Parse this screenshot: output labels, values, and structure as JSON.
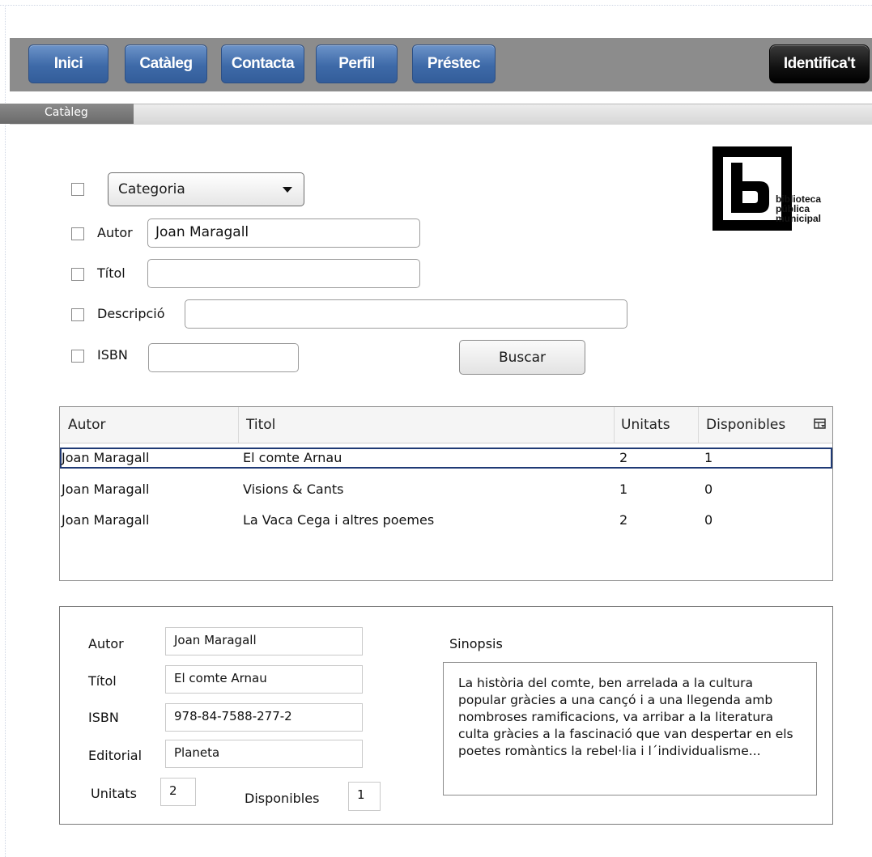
{
  "nav": {
    "inici": "Inici",
    "cataleg": "Catàleg",
    "contacta": "Contacta",
    "perfil": "Perfil",
    "prestec": "Préstec",
    "identificat": "Identifica't"
  },
  "tab": {
    "label": "Catàleg"
  },
  "search": {
    "category_select": "Categoria",
    "autor_label": "Autor",
    "autor_value": "Joan Maragall",
    "titol_label": "Títol",
    "titol_value": "",
    "descripcio_label": "Descripció",
    "descripcio_value": "",
    "isbn_label": "ISBN",
    "isbn_value": "",
    "search_button": "Buscar"
  },
  "logo": {
    "line1": "biblioteca",
    "line2": "pública",
    "line3": "municipal"
  },
  "results": {
    "columns": [
      "Autor",
      "Titol",
      "Unitats",
      "Disponibles"
    ],
    "rows": [
      [
        "Joan Maragall",
        "El comte Arnau",
        "2",
        "1"
      ],
      [
        "Joan Maragall",
        "Visions & Cants",
        "1",
        "0"
      ],
      [
        "Joan Maragall",
        "La Vaca Cega i altres poemes",
        "2",
        "0"
      ]
    ],
    "selected_row": 0
  },
  "detail": {
    "autor_label": "Autor",
    "autor_value": "Joan Maragall",
    "titol_label": "Títol",
    "titol_value": "El comte Arnau",
    "isbn_label": "ISBN",
    "isbn_value": "978-84-7588-277-2",
    "editorial_label": "Editorial",
    "editorial_value": "Planeta",
    "unitats_label": "Unitats",
    "unitats_value": "2",
    "disponibles_label": "Disponibles",
    "disponibles_value": "1",
    "sinopsis_label": "Sinopsis",
    "sinopsis_text": "La història del comte, ben arrelada a la cultura popular gràcies a una cançó i a una llegenda amb nombroses ramificacions, va arribar a la literatura culta gràcies a la fascinació que van despertar en els poetes romàntics la rebel·lia i l´individualisme..."
  }
}
